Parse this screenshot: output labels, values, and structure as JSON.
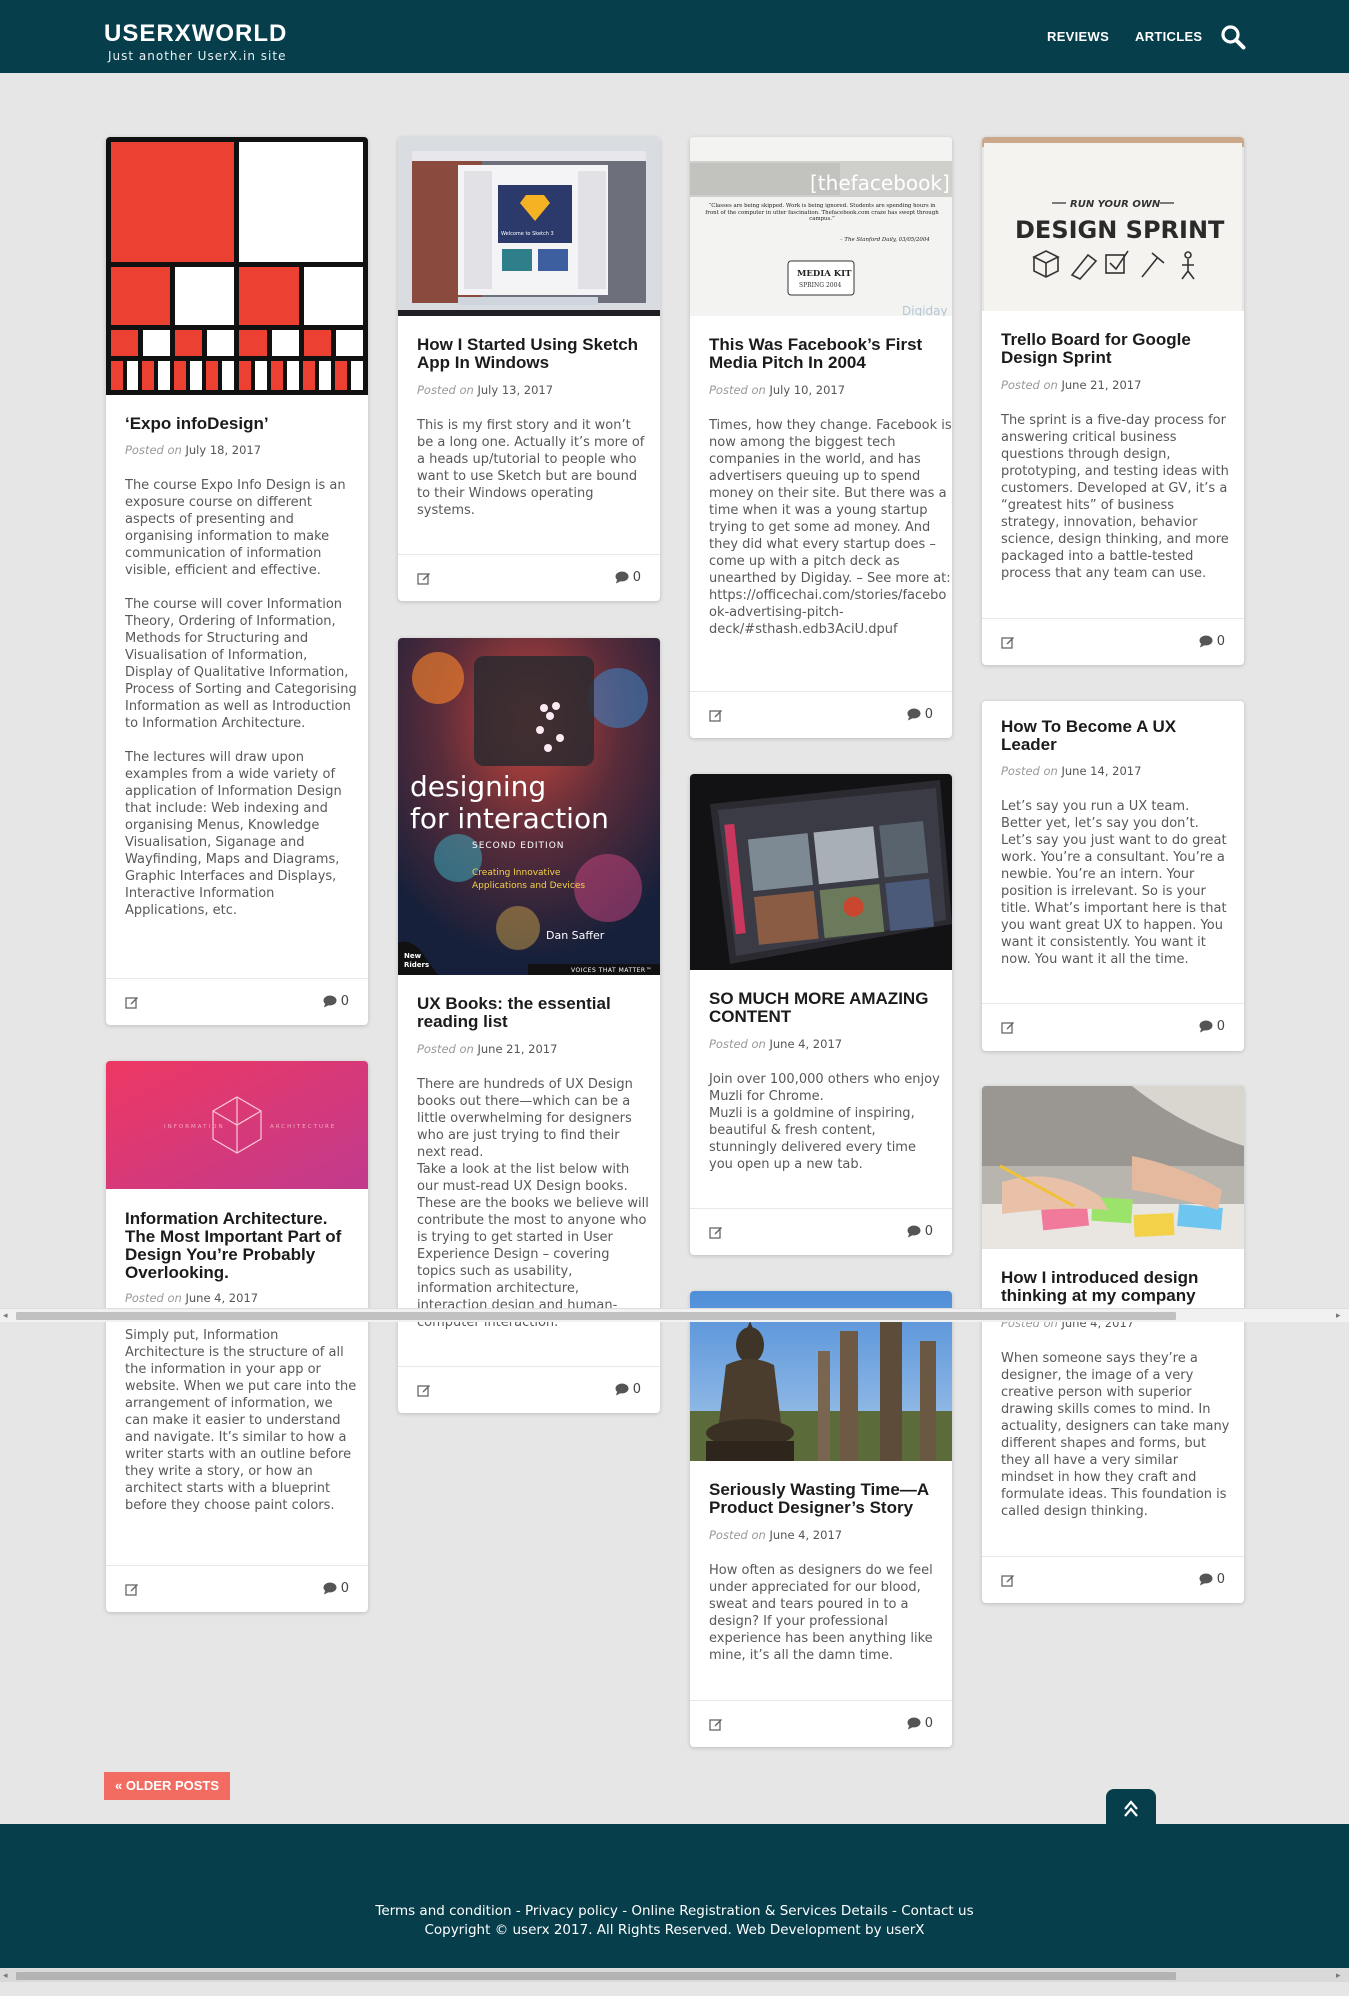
{
  "header": {
    "site_title": "USERXWORLD",
    "tagline": "Just another UserX.in site",
    "nav": [
      "REVIEWS",
      "ARTICLES"
    ]
  },
  "posts": [
    {
      "title": "‘Expo infoDesign’",
      "posted_label": "Posted on",
      "date": "July 18, 2017",
      "excerpt": "The course Expo Info Design is an exposure course on different aspects of presenting and organising information to make communication of information visible, efficient and effective.\n\nThe course will cover Information Theory, Ordering of Information, Methods for Structuring and Visualisation of Information, Display of Qualitative Information, Process of Sorting and Categorising Information as well as Introduction to Information Architecture.\n\nThe lectures will draw upon examples from a wide variety of application of Information Design that include: Web indexing and organising Menus, Knowledge Visualisation, Siganage and Wayfinding, Maps and Diagrams, Graphic Interfaces and Displays, Interactive Information Applications, etc.",
      "comments": "0"
    },
    {
      "title": "Information Architecture. The Most Important Part of Design You’re Probably Overlooking.",
      "posted_label": "Posted on",
      "date": "June 4, 2017",
      "excerpt": "Simply put, Information Architecture is the structure of all the information in your app or website. When we put care into the arrangement of information, we can make it easier to understand and navigate. It’s similar to how a writer starts with an outline before they write a story, or how an architect starts with a blueprint before they choose paint colors.",
      "image_text_left": "INFORMATION",
      "image_text_right": "ARCHITECTURE",
      "comments": "0"
    },
    {
      "title": "How I Started Using Sketch App In Windows",
      "posted_label": "Posted on",
      "date": "July 13, 2017",
      "excerpt": "This is my first story and it won’t be a long one. Actually it’s more of a heads up/tutorial to people who want to use Sketch but are bound to their Windows operating systems.",
      "image_text": "Welcome to Sketch 3",
      "comments": "0"
    },
    {
      "title": "UX Books: the essential reading list",
      "posted_label": "Posted on",
      "date": "June 21, 2017",
      "excerpt": "There are hundreds of UX Design books out there—which can be a little overwhelming for designers who are just trying to find their next read.\nTake a look at the list below with our must-read UX Design books. These are the books we believe will contribute the most to anyone who is trying to get started in User Experience Design – covering topics such as usability, information architecture, interaction design and human-computer interaction.",
      "book": {
        "title_line1": "designing",
        "title_line2": "for interaction",
        "edition": "SECOND EDITION",
        "subtitle_line1": "Creating Innovative",
        "subtitle_line2": "Applications and Devices",
        "author": "Dan Saffer",
        "publisher_line1": "New",
        "publisher_line2": "Riders",
        "series": "VOICES THAT MATTER™"
      },
      "comments": "0"
    },
    {
      "title": "This Was Facebook’s First Media Pitch In 2004",
      "posted_label": "Posted on",
      "date": "July 10, 2017",
      "excerpt": "Times, how they change. Facebook is now among the biggest tech companies in the world, and has advertisers queuing up to spend money on their site. But there was a time when it was a young startup trying to get some ad money. And they did what every startup does – come up with a pitch deck as unearthed by Digiday. – See more at: https://officechai.com/stories/facebook-advertising-pitch-deck/#sthash.edb3AciU.dpuf",
      "image_text": {
        "brand": "[thefacebook]",
        "quote": "“Classes are being skipped. Work is being ignored. Students are spending hours in front of the computer in utter fascination. Thefacebook.com craze has swept through campus.”",
        "source": "– The Stanford Daily, 03/05/2004",
        "kit_line1": "MEDIA KIT",
        "kit_line2": "SPRING 2004",
        "watermark": "Digiday"
      },
      "comments": "0"
    },
    {
      "title": "SO MUCH MORE AMAZING CONTENT",
      "posted_label": "Posted on",
      "date": "June 4, 2017",
      "excerpt": "Join over 100,000 others who enjoy Muzli for Chrome.\nMuzli is a goldmine of inspiring, beautiful & fresh content, stunningly delivered every time you open up a new tab.",
      "comments": "0"
    },
    {
      "title": "Seriously Wasting Time—A Product Designer’s Story",
      "posted_label": "Posted on",
      "date": "June 4, 2017",
      "excerpt": "How often as designers do we feel under appreciated for our blood, sweat and tears poured in to a design? If your professional experience has been anything like mine, it’s all the damn time.",
      "comments": "0"
    },
    {
      "title": "Trello Board for Google Design Sprint",
      "posted_label": "Posted on",
      "date": "June 21, 2017",
      "excerpt": "The sprint is a five-day process for answering critical business questions through design, prototyping, and testing ideas with customers. Developed at GV, it’s a “greatest hits” of business strategy, innovation, behavior science, design thinking, and more packaged into a battle-tested process that any team can use.",
      "image_text": {
        "line1": "RUN YOUR OWN",
        "line2": "DESIGN SPRINT"
      },
      "comments": "0"
    },
    {
      "title": "How To Become A UX Leader",
      "posted_label": "Posted on",
      "date": "June 14, 2017",
      "excerpt": "Let’s say you run a UX team. Better yet, let’s say you don’t. Let’s say you just want to do great work. You’re a consultant. You’re a newbie. You’re an intern. Your position is irrelevant. So is your title. What’s important here is that you want great UX to happen. You want it consistently. You want it now. You want it all the time.",
      "comments": "0"
    },
    {
      "title": "How I introduced design thinking at my company",
      "posted_label": "Posted on",
      "date": "June 4, 2017",
      "excerpt": "When someone says they’re a designer, the image of a very creative person with superior drawing skills comes to mind. In actuality, designers can take many different shapes and forms, but they all have a very similar mindset in how they craft and formulate ideas. This foundation is called design thinking.",
      "comments": "0"
    }
  ],
  "pagination": {
    "older_label": "« OLDER POSTS"
  },
  "footer": {
    "links": "Terms and condition - Privacy policy - Online Registration & Services Details - Contact us",
    "copyright": "Copyright © userx 2017. All Rights Reserved. Web Development by userX"
  },
  "colors": {
    "header_bg": "#063e4c",
    "accent": "#f26c62",
    "page_bg": "#e6e6e6"
  },
  "icons": [
    "search-icon",
    "edit-icon",
    "comment-icon",
    "chevron-up-icon"
  ]
}
